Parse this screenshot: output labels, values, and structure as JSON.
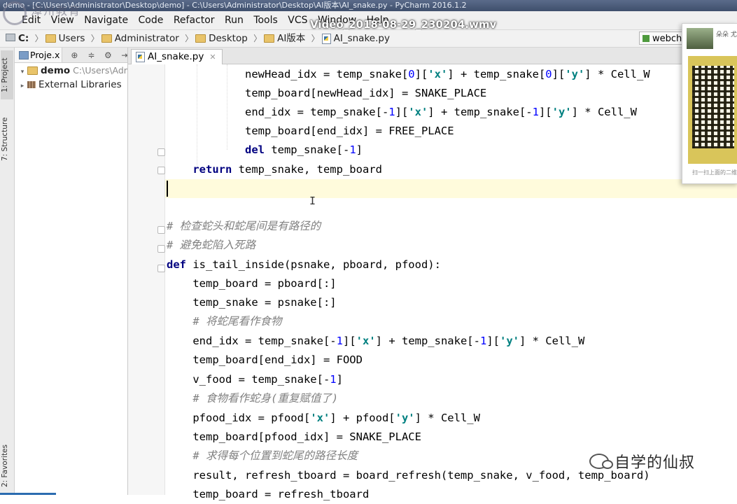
{
  "window": {
    "title": "demo - [C:\\Users\\Administrator\\Desktop\\demo] - C:\\Users\\Administrator\\Desktop\\AI版本\\AI_snake.py - PyCharm 2016.1.2",
    "watermark": "漳州教育"
  },
  "video_title": "Video_2018-08-29_230204.wmv",
  "menu": [
    "Edit",
    "View",
    "Navigate",
    "Code",
    "Refactor",
    "Run",
    "Tools",
    "VCS",
    "Window",
    "Help"
  ],
  "breadcrumbs": [
    "C:",
    "Users",
    "Administrator",
    "Desktop",
    "AI版本",
    "AI_snake.py"
  ],
  "run_config": "webcha",
  "left_tabs": {
    "project": "1: Project",
    "structure": "7: Structure",
    "favorites": "2: Favorites"
  },
  "project_panel": {
    "header": "Proje.x",
    "tree": [
      {
        "name": "demo",
        "path": "C:\\Users\\Adm"
      },
      {
        "name": "External Libraries",
        "path": ""
      }
    ]
  },
  "editor": {
    "tab": "AI_snake.py",
    "lines": [
      "            newHead_idx = temp_snake[0]['x'] + temp_snake[0]['y'] * Cell_W",
      "            temp_board[newHead_idx] = SNAKE_PLACE",
      "            end_idx = temp_snake[-1]['x'] + temp_snake[-1]['y'] * Cell_W",
      "            temp_board[end_idx] = FREE_PLACE",
      "            del temp_snake[-1]",
      "    return temp_snake, temp_board",
      "",
      "",
      "# 检查蛇头和蛇尾间是有路径的",
      "# 避免蛇陷入死路",
      "def is_tail_inside(psnake, pboard, pfood):",
      "    temp_board = pboard[:]",
      "    temp_snake = psnake[:]",
      "    # 将蛇尾看作食物",
      "    end_idx = temp_snake[-1]['x'] + temp_snake[-1]['y'] * Cell_W",
      "    temp_board[end_idx] = FOOD",
      "    v_food = temp_snake[-1]",
      "    # 食物看作蛇身(重复赋值了)",
      "    pfood_idx = pfood['x'] + pfood['y'] * Cell_W",
      "    temp_board[pfood_idx] = SNAKE_PLACE",
      "    # 求得每个位置到蛇尾的路径长度",
      "    result, refresh_tboard = board_refresh(temp_snake, v_food, temp_board)",
      "    temp_board = refresh_tboard"
    ]
  },
  "wechat_card": {
    "name": "朵朵 尤",
    "scan_hint": "扫一扫上面的二维码"
  },
  "footer_watermark": "自学的仙叔",
  "colors": {
    "keyword": "#000080",
    "string": "#008080",
    "comment": "#808080",
    "caret_line": "#fffbdc"
  }
}
